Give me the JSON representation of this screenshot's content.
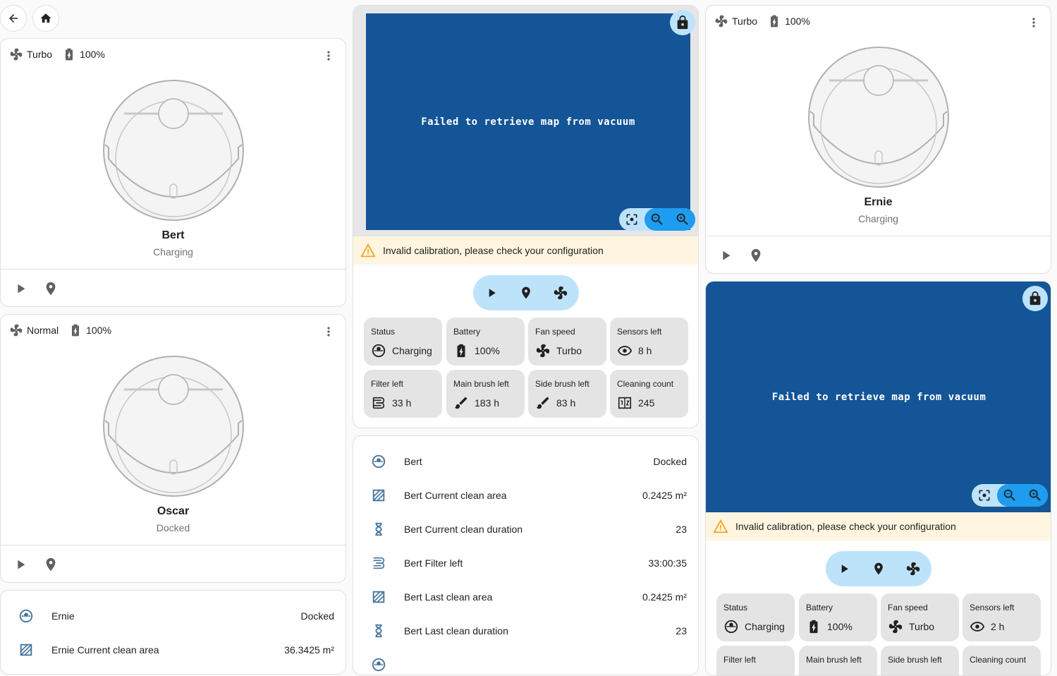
{
  "left_column": {
    "cards": [
      {
        "fan": "Turbo",
        "battery": "100%",
        "name": "Bert",
        "state": "Charging"
      },
      {
        "fan": "Normal",
        "battery": "100%",
        "name": "Oscar",
        "state": "Docked"
      }
    ],
    "entities": {
      "rows": [
        {
          "name": "Ernie",
          "value": "Docked"
        },
        {
          "name": "Ernie Current clean area",
          "value": "36.3425 m²"
        }
      ]
    }
  },
  "map_card_1": {
    "message": "Failed to retrieve map from vacuum",
    "warning": "Invalid calibration, please check your configuration",
    "tiles": [
      {
        "label": "Status",
        "value": "Charging"
      },
      {
        "label": "Battery",
        "value": "100%"
      },
      {
        "label": "Fan speed",
        "value": "Turbo"
      },
      {
        "label": "Sensors left",
        "value": "8 h"
      },
      {
        "label": "Filter left",
        "value": "33 h"
      },
      {
        "label": "Main brush left",
        "value": "183 h"
      },
      {
        "label": "Side brush left",
        "value": "83 h"
      },
      {
        "label": "Cleaning count",
        "value": "245"
      }
    ]
  },
  "entities_card": {
    "rows": [
      {
        "name": "Bert",
        "value": "Docked"
      },
      {
        "name": "Bert Current clean area",
        "value": "0.2425 m²"
      },
      {
        "name": "Bert Current clean duration",
        "value": "23"
      },
      {
        "name": "Bert Filter left",
        "value": "33:00:35"
      },
      {
        "name": "Bert Last clean area",
        "value": "0.2425 m²"
      },
      {
        "name": "Bert Last clean duration",
        "value": "23"
      }
    ]
  },
  "right_column": {
    "card": {
      "fan": "Turbo",
      "battery": "100%",
      "name": "Ernie",
      "state": "Charging"
    },
    "map": {
      "message": "Failed to retrieve map from vacuum",
      "warning": "Invalid calibration, please check your configuration",
      "tiles": [
        {
          "label": "Status",
          "value": "Charging"
        },
        {
          "label": "Battery",
          "value": "100%"
        },
        {
          "label": "Fan speed",
          "value": "Turbo"
        },
        {
          "label": "Sensors left",
          "value": "2 h"
        },
        {
          "label": "Filter left",
          "value": ""
        },
        {
          "label": "Main brush left",
          "value": ""
        },
        {
          "label": "Side brush left",
          "value": ""
        },
        {
          "label": "Cleaning count",
          "value": ""
        }
      ]
    }
  },
  "colors": {
    "map_bg": "#135596",
    "accent": "#1e9cf0",
    "accent_light": "#bde3fb",
    "warning_bg": "#fff5e0",
    "tile_bg": "#e4e4e4"
  }
}
